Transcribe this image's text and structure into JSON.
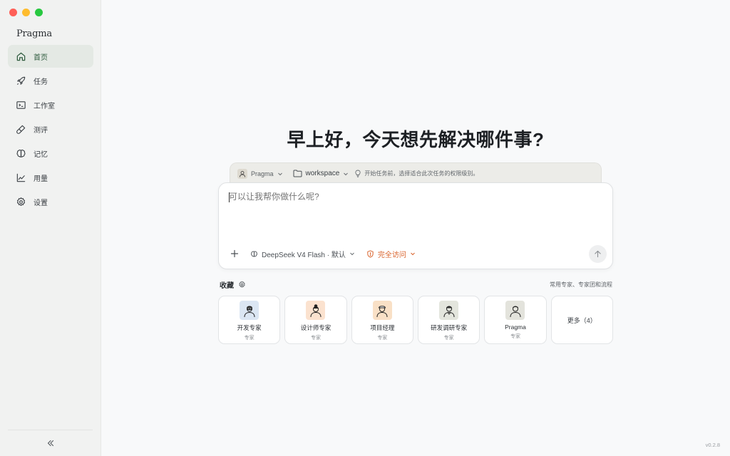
{
  "app": {
    "brand": "Pragma",
    "version": "v0.2.8"
  },
  "sidebar": {
    "items": [
      {
        "label": "首页",
        "icon": "home-icon",
        "active": true
      },
      {
        "label": "任务",
        "icon": "rocket-icon",
        "active": false
      },
      {
        "label": "工作室",
        "icon": "terminal-icon",
        "active": false
      },
      {
        "label": "测评",
        "icon": "test-tube-icon",
        "active": false
      },
      {
        "label": "记忆",
        "icon": "brain-icon",
        "active": false
      },
      {
        "label": "用量",
        "icon": "chart-line-icon",
        "active": false
      },
      {
        "label": "设置",
        "icon": "gear-icon",
        "active": false
      }
    ],
    "collapse_icon": "chevrons-left-icon"
  },
  "main": {
    "greeting": "早上好，今天想先解决哪件事?",
    "context": {
      "agent": "Pragma",
      "workspace": "workspace",
      "hint": "开始任务前，选择适合此次任务的权限级别。"
    },
    "composer": {
      "placeholder": "可以让我帮你做什么呢?",
      "model": "DeepSeek V4 Flash · 默认",
      "access": "完全访问"
    },
    "favorites": {
      "title": "收藏",
      "link": "常用专家、专家团和流程",
      "cards": [
        {
          "name": "开发专家",
          "role": "专家",
          "avatar_bg": "#dbe6f3"
        },
        {
          "name": "设计师专家",
          "role": "专家",
          "avatar_bg": "#fbe2cf"
        },
        {
          "name": "项目经理",
          "role": "专家",
          "avatar_bg": "#f9e0c6"
        },
        {
          "name": "研发调研专家",
          "role": "专家",
          "avatar_bg": "#e3e5dd"
        },
        {
          "name": "Pragma",
          "role": "专家",
          "avatar_bg": "#e3e3dc"
        }
      ],
      "more": "更多（4）"
    }
  },
  "colors": {
    "accent": "#2d5a3d",
    "access": "#d9622b",
    "active_bg": "#e4e9e4"
  }
}
